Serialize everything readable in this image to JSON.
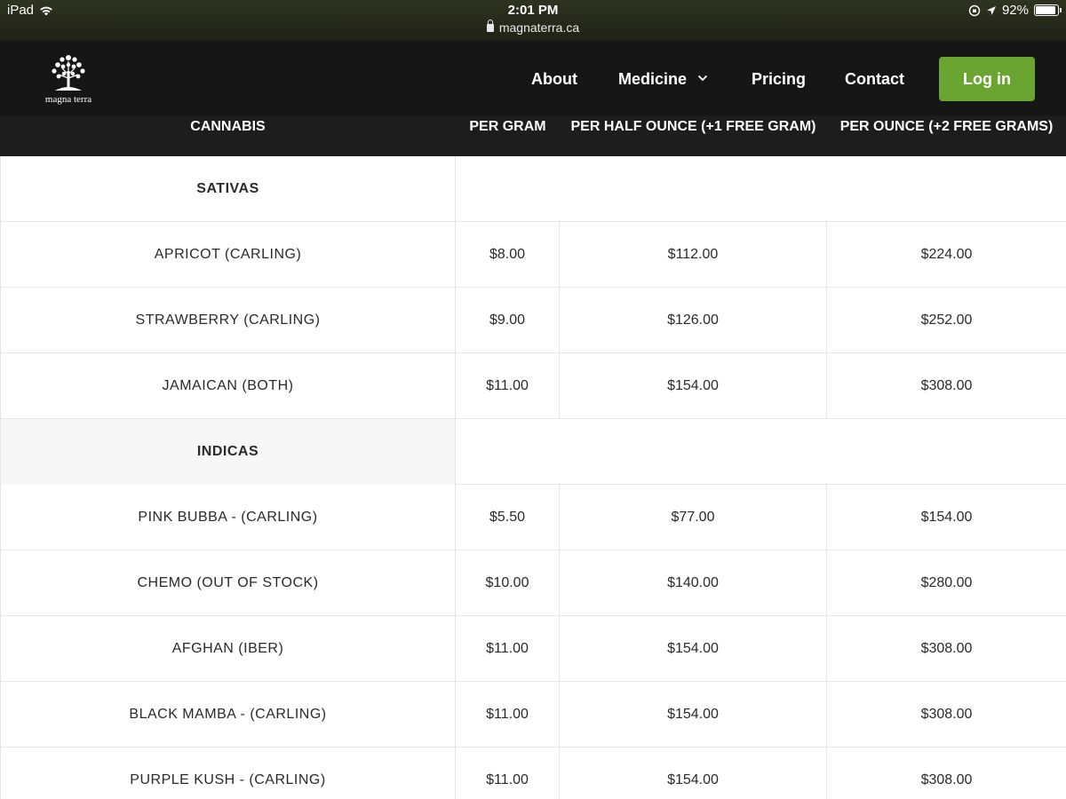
{
  "statusbar": {
    "device": "iPad",
    "time": "2:01 PM",
    "url": "magnaterra.ca",
    "battery": "92%"
  },
  "brand": {
    "logo_text": "magna terra",
    "accent": "#6aa532"
  },
  "nav": {
    "about": "About",
    "medicine": "Medicine",
    "pricing": "Pricing",
    "contact": "Contact",
    "login": "Log in"
  },
  "table": {
    "headers": [
      "CANNABIS",
      "PER GRAM",
      "PER HALF OUNCE (+1 FREE GRAM)",
      "PER OUNCE (+2 FREE GRAMS)"
    ],
    "rows": [
      {
        "type": "section",
        "name": "SATIVAS"
      },
      {
        "type": "item",
        "name": "APRICOT (CARLING)",
        "gram": "$8.00",
        "half": "$112.00",
        "ounce": "$224.00"
      },
      {
        "type": "item",
        "name": "STRAWBERRY (CARLING)",
        "gram": "$9.00",
        "half": "$126.00",
        "ounce": "$252.00"
      },
      {
        "type": "item",
        "name": "JAMAICAN (BOTH)",
        "gram": "$11.00",
        "half": "$154.00",
        "ounce": "$308.00"
      },
      {
        "type": "section",
        "name": "INDICAS"
      },
      {
        "type": "item",
        "name": "PINK BUBBA - (CARLING)",
        "gram": "$5.50",
        "half": "$77.00",
        "ounce": "$154.00"
      },
      {
        "type": "item",
        "name": "CHEMO (OUT OF STOCK)",
        "gram": "$10.00",
        "half": "$140.00",
        "ounce": "$280.00"
      },
      {
        "type": "item",
        "name": "AFGHAN (IBER)",
        "gram": "$11.00",
        "half": "$154.00",
        "ounce": "$308.00"
      },
      {
        "type": "item",
        "name": "BLACK MAMBA - (CARLING)",
        "gram": "$11.00",
        "half": "$154.00",
        "ounce": "$308.00"
      },
      {
        "type": "item",
        "name": "PURPLE KUSH - (CARLING)",
        "gram": "$11.00",
        "half": "$154.00",
        "ounce": "$308.00"
      }
    ]
  }
}
